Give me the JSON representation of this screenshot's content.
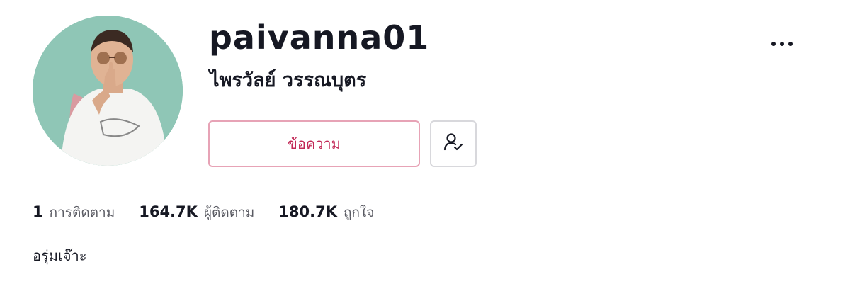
{
  "profile": {
    "username": "paivanna01",
    "display_name": "ไพรวัลย์ วรรณบุตร",
    "bio": "อรุ่มเจ๊าะ"
  },
  "actions": {
    "message_label": "ข้อความ",
    "follow_icon": "user-check-icon",
    "more_icon": "ellipsis-icon"
  },
  "stats": {
    "following": {
      "value": "1",
      "label": "การติดตาม"
    },
    "followers": {
      "value": "164.7K",
      "label": "ผู้ติดตาม"
    },
    "likes": {
      "value": "180.7K",
      "label": "ถูกใจ"
    }
  },
  "colors": {
    "accent": "#c22957",
    "accent_border": "#e7a3b6",
    "avatar_bg": "#8fc6b6",
    "text_primary": "#161823",
    "text_secondary": "#5a5b63"
  }
}
